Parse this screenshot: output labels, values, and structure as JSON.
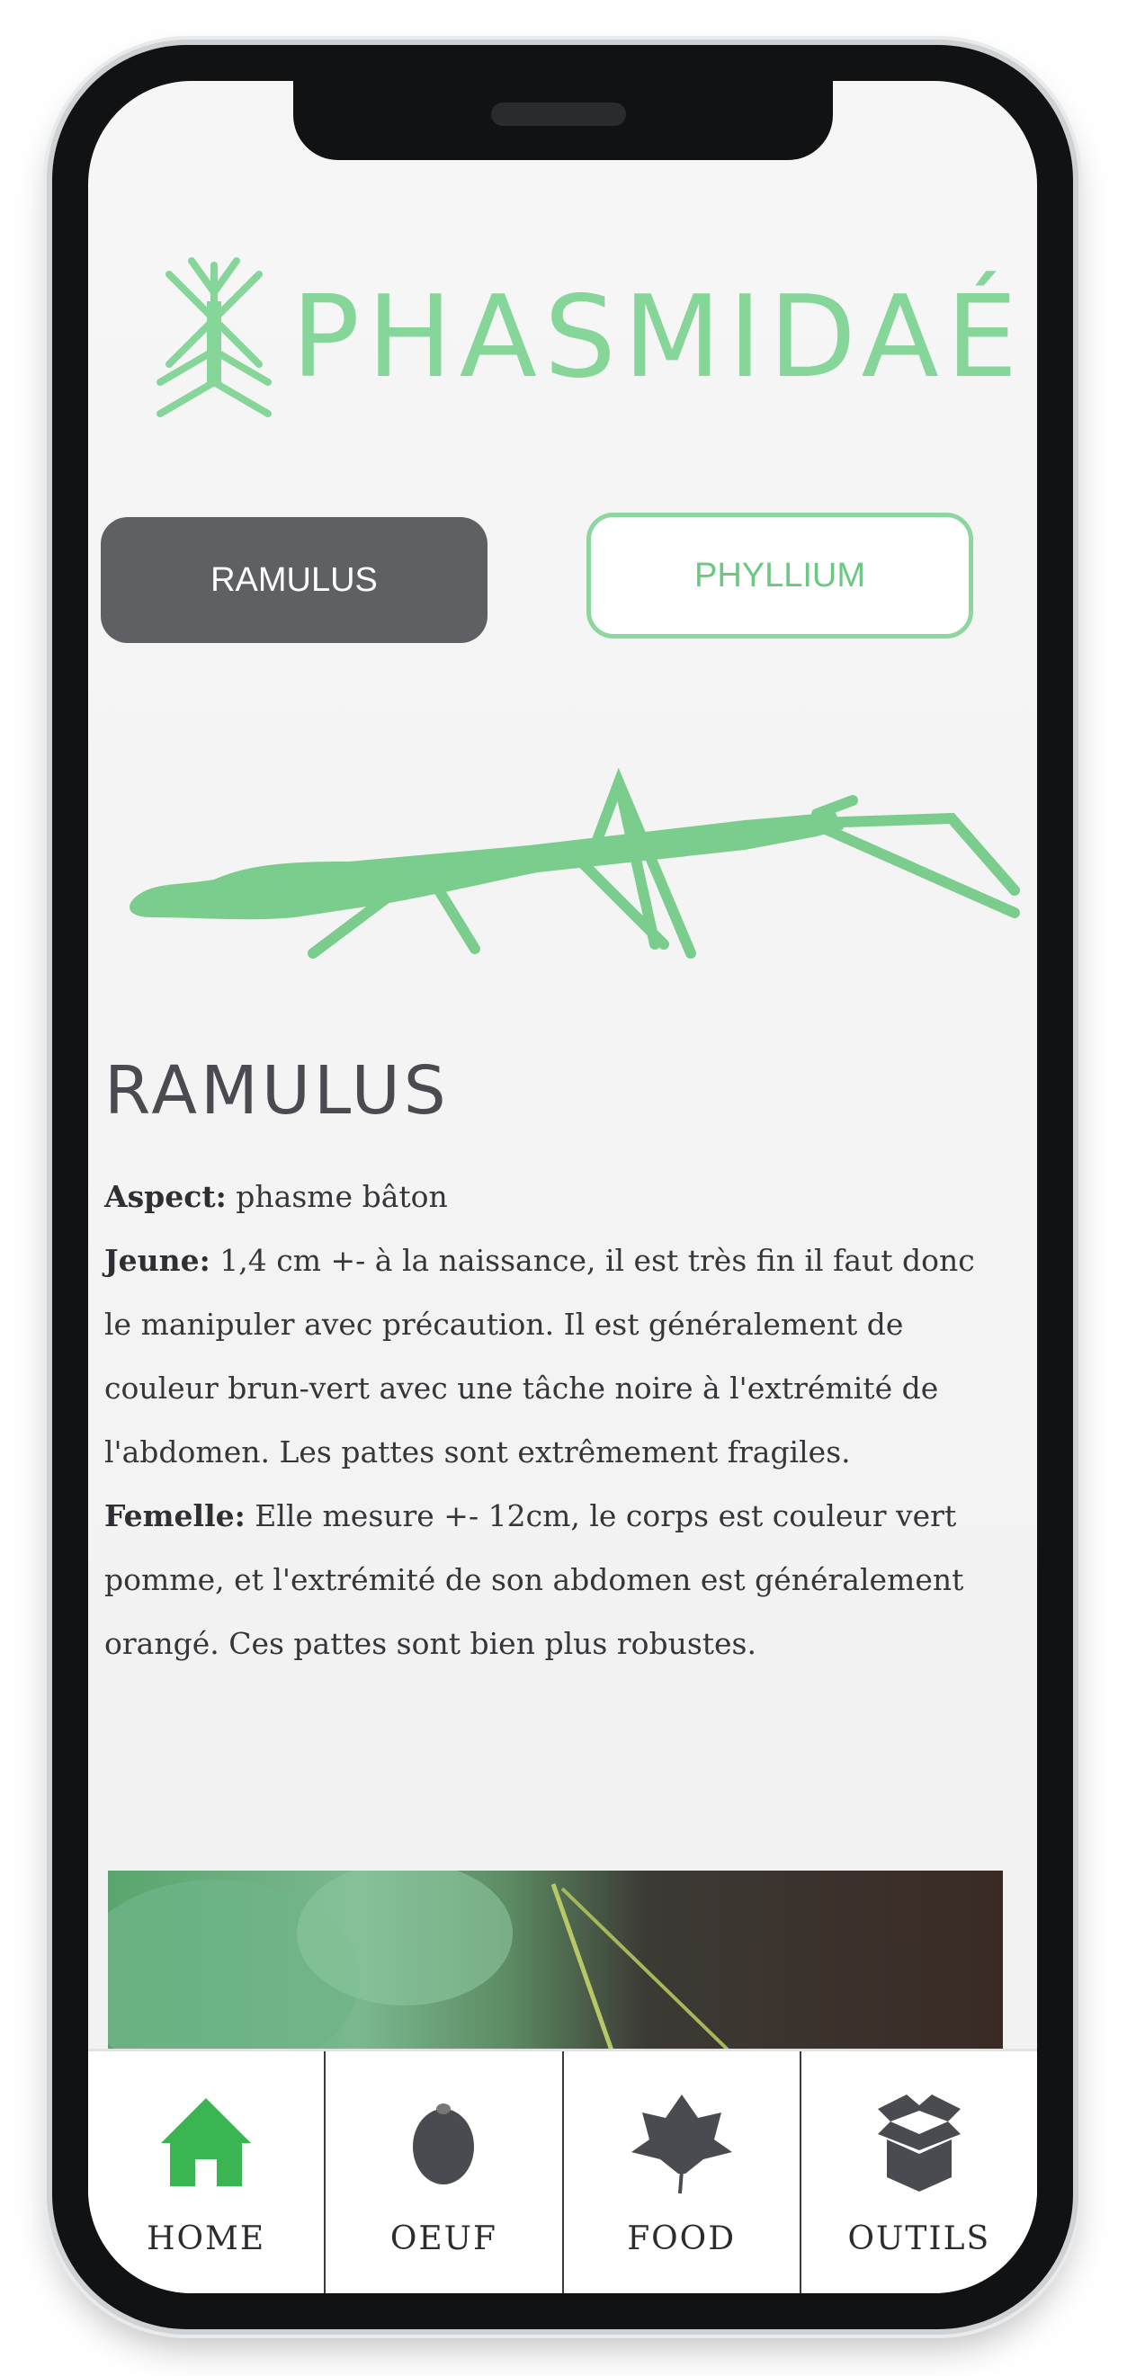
{
  "app": {
    "title": "PHASMIDAÉ",
    "accent_color": "#86d69a",
    "dark_color": "#5f6064"
  },
  "tabs": [
    {
      "label": "RAMULUS",
      "active": true
    },
    {
      "label": "PHYLLIUM",
      "active": false
    }
  ],
  "species": {
    "title": "RAMULUS",
    "image_icon": "stick-insect-silhouette-icon",
    "paragraphs": [
      {
        "label": "Aspect:",
        "text": " phasme bâton"
      },
      {
        "label": "Jeune:",
        "text": " 1,4 cm +- à la naissance, il est très fin il faut donc le manipuler avec précaution. Il est généralement de couleur brun-vert avec une tâche noire à l'extrémité de l'abdomen. Les pattes sont extrêmement fragiles."
      },
      {
        "label": "Femelle:",
        "text": " Elle mesure +- 12cm, le corps est couleur vert pomme, et l'extrémité de son abdomen est généralement orangé. Ces pattes sont bien plus robustes."
      }
    ]
  },
  "nav": [
    {
      "label": "HOME",
      "icon": "home-icon",
      "active": true,
      "color": "#3bb552"
    },
    {
      "label": "OEUF",
      "icon": "egg-icon",
      "active": false,
      "color": "#4a4b50"
    },
    {
      "label": "FOOD",
      "icon": "leaf-icon",
      "active": false,
      "color": "#4a4b50"
    },
    {
      "label": "OUTILS",
      "icon": "box-icon",
      "active": false,
      "color": "#4a4b50"
    }
  ]
}
